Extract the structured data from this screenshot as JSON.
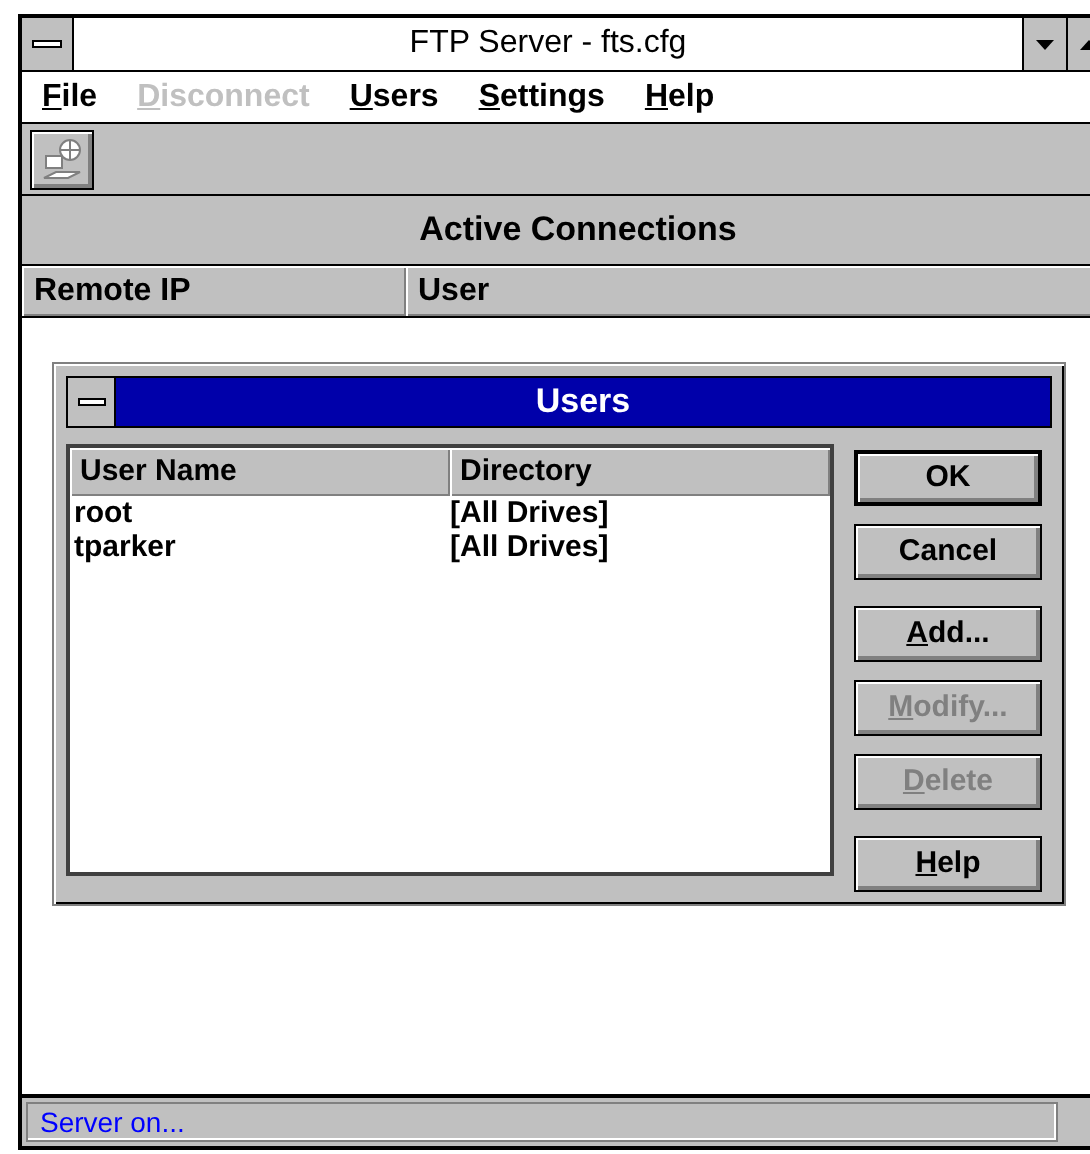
{
  "window": {
    "title": "FTP Server - fts.cfg"
  },
  "menu": [
    {
      "label": "File",
      "disabled": false
    },
    {
      "label": "Disconnect",
      "disabled": true
    },
    {
      "label": "Users",
      "disabled": false
    },
    {
      "label": "Settings",
      "disabled": false
    },
    {
      "label": "Help",
      "disabled": false
    }
  ],
  "panel": {
    "title": "Active Connections",
    "columns": [
      "Remote IP",
      "User"
    ]
  },
  "dialog": {
    "title": "Users",
    "columns": [
      "User Name",
      "Directory"
    ],
    "rows": [
      [
        "root",
        "[All Drives]"
      ],
      [
        "tparker",
        "[All Drives]"
      ]
    ],
    "buttons": [
      {
        "label": "OK",
        "disabled": false,
        "default": true,
        "mnemonic": false
      },
      {
        "label": "Cancel",
        "disabled": false,
        "default": false,
        "mnemonic": false
      },
      {
        "label": "Add...",
        "disabled": false,
        "default": false,
        "mnemonic": true
      },
      {
        "label": "Modify...",
        "disabled": true,
        "default": false,
        "mnemonic": true
      },
      {
        "label": "Delete",
        "disabled": true,
        "default": false,
        "mnemonic": true
      },
      {
        "label": "Help",
        "disabled": false,
        "default": false,
        "mnemonic": true
      }
    ]
  },
  "status_bar": "Server on..."
}
